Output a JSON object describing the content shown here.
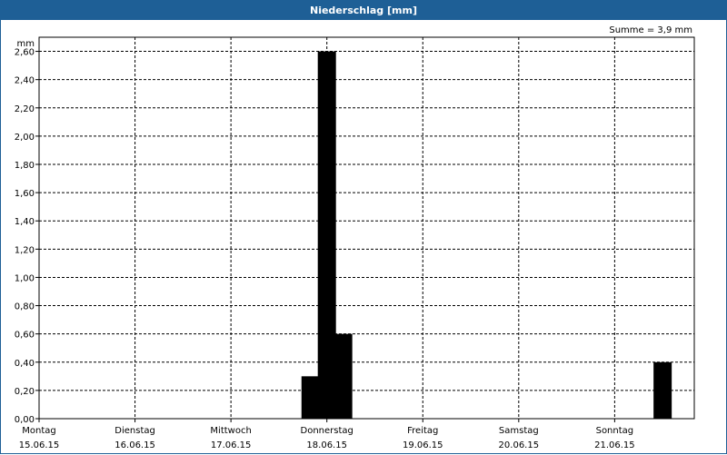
{
  "window": {
    "title": "Niederschlag [mm]"
  },
  "chart_data": {
    "type": "bar",
    "title": "Niederschlag [mm]",
    "annotation": "Summe = 3,9 mm",
    "ylabel": "mm",
    "xlabel": "",
    "ylim": [
      0,
      2.7
    ],
    "yticks": [
      "0,00",
      "0,20",
      "0,40",
      "0,60",
      "0,80",
      "1,00",
      "1,20",
      "1,40",
      "1,60",
      "1,80",
      "2,00",
      "2,20",
      "2,40",
      "2,60"
    ],
    "ytick_values": [
      0,
      0.2,
      0.4,
      0.6,
      0.8,
      1.0,
      1.2,
      1.4,
      1.6,
      1.8,
      2.0,
      2.2,
      2.4,
      2.6
    ],
    "xlim": [
      0,
      6.83
    ],
    "x_unit": "days since Montag 15.06.15 00:00",
    "xticks": [
      {
        "day": "Montag",
        "date": "15.06.15"
      },
      {
        "day": "Dienstag",
        "date": "16.06.15"
      },
      {
        "day": "Mittwoch",
        "date": "17.06.15"
      },
      {
        "day": "Donnerstag",
        "date": "18.06.15"
      },
      {
        "day": "Freitag",
        "date": "19.06.15"
      },
      {
        "day": "Samstag",
        "date": "20.06.15"
      },
      {
        "day": "Sonntag",
        "date": "21.06.15"
      }
    ],
    "series": [
      {
        "name": "Niederschlag",
        "color": "#000000",
        "points": [
          {
            "x": 2.83,
            "value": 0.3
          },
          {
            "x": 3.0,
            "value": 2.6
          },
          {
            "x": 3.17,
            "value": 0.6
          },
          {
            "x": 6.5,
            "value": 0.4
          }
        ]
      }
    ],
    "grid": true,
    "grid_style": "dashed"
  }
}
